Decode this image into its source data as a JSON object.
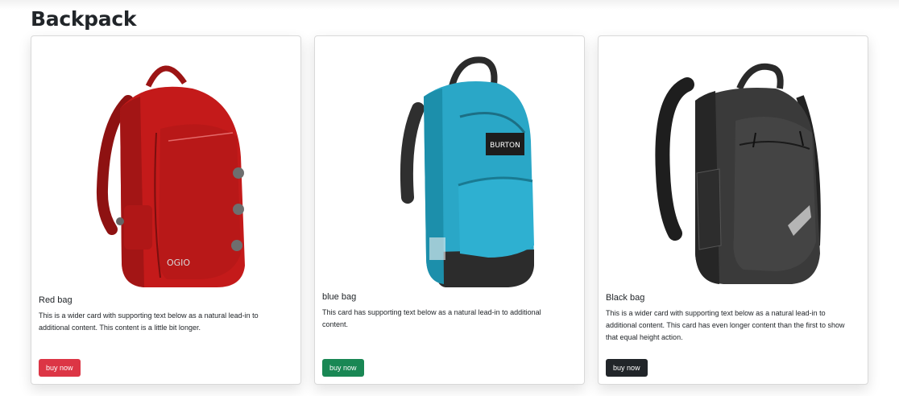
{
  "page": {
    "title": "Backpack"
  },
  "cards": [
    {
      "title": "Red bag",
      "text": "This is a wider card with supporting text below as a natural lead-in to additional content. This content is a little bit longer.",
      "button_label": "buy now",
      "button_color": "#dc3545",
      "image": "red-backpack-image",
      "brand_text": "OGIO"
    },
    {
      "title": "blue bag",
      "text": "This card has supporting text below as a natural lead-in to additional content.",
      "button_label": "buy now",
      "button_color": "#198754",
      "image": "blue-backpack-image",
      "brand_text": "BURTON"
    },
    {
      "title": "Black bag",
      "text": "This is a wider card with supporting text below as a natural lead-in to additional content. This card has even longer content than the first to show that equal height action.",
      "button_label": "buy now",
      "button_color": "#212529",
      "image": "black-backpack-image"
    }
  ]
}
